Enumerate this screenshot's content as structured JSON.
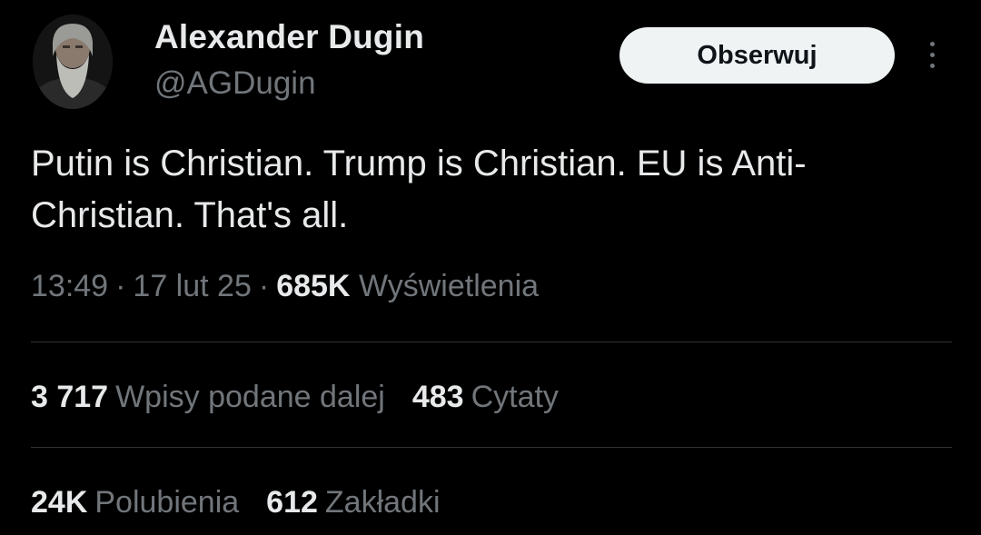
{
  "author": {
    "display_name": "Alexander Dugin",
    "handle": "@AGDugin"
  },
  "follow_button": {
    "label": "Obserwuj"
  },
  "more_menu": {
    "icon": "more-vertical-icon"
  },
  "tweet": {
    "text": "Putin is Christian. Trump is Christian. EU is Anti-Christian. That's all."
  },
  "meta": {
    "time": "13:49",
    "separator": "·",
    "date": "17 lut 25",
    "views_count": "685K",
    "views_label": "Wyświetlenia"
  },
  "stats": {
    "reposts": {
      "count": "3 717",
      "label": "Wpisy podane dalej"
    },
    "quotes": {
      "count": "483",
      "label": "Cytaty"
    },
    "likes": {
      "count": "24K",
      "label": "Polubienia"
    },
    "bookmarks": {
      "count": "612",
      "label": "Zakładki"
    }
  },
  "colors": {
    "background": "#000000",
    "text_primary": "#e7e9ea",
    "text_secondary": "#71767b",
    "button_bg": "#eff3f4",
    "divider": "#2f3336"
  }
}
